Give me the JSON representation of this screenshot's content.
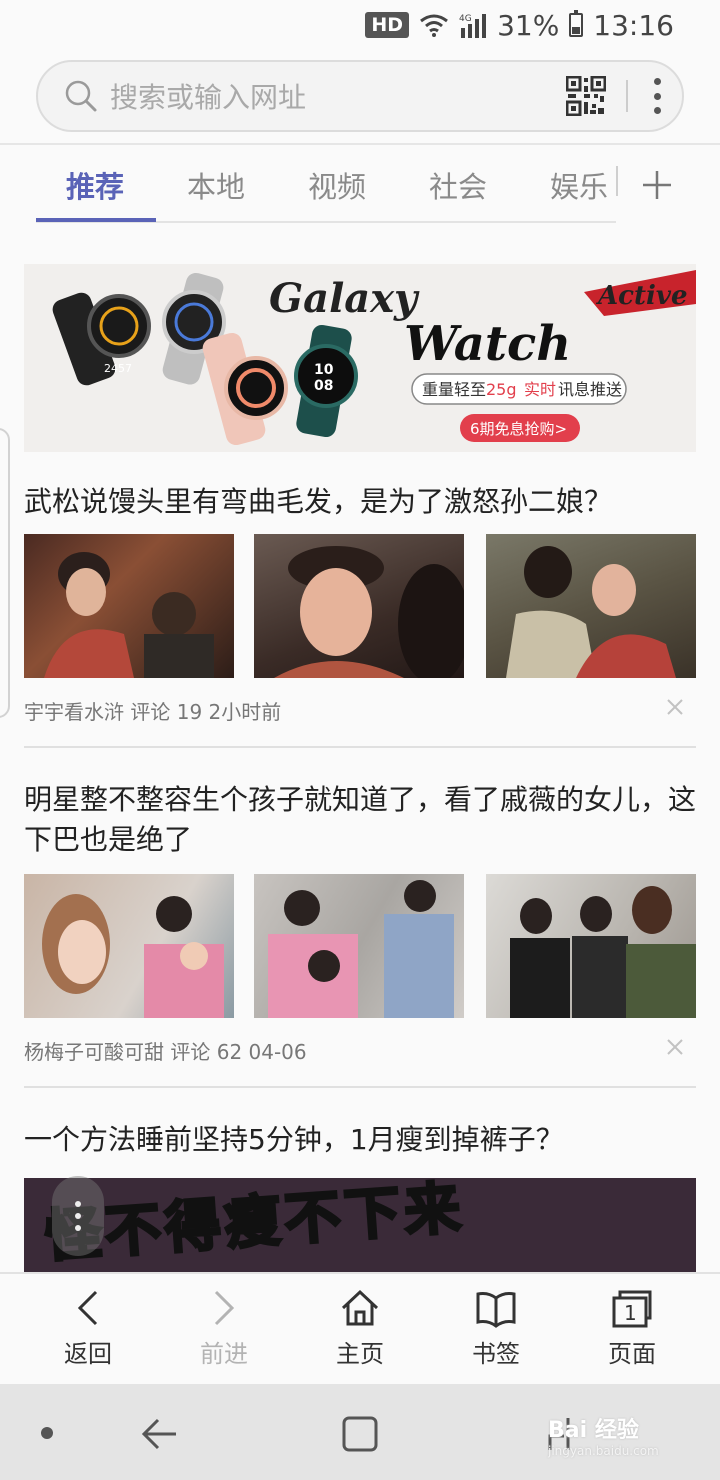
{
  "status_bar": {
    "hd": "HD",
    "battery": "31%",
    "time": "13:16"
  },
  "search": {
    "placeholder": "搜索或输入网址"
  },
  "tabs": [
    {
      "label": "推荐",
      "active": true
    },
    {
      "label": "本地"
    },
    {
      "label": "视频"
    },
    {
      "label": "社会"
    },
    {
      "label": "娱乐"
    }
  ],
  "banner": {
    "title_line1": "Galaxy",
    "title_line2": "Watch",
    "tag": "Active",
    "watch_time_1": "2457",
    "watch_time_2": "10",
    "watch_time_3": "08",
    "feature_a": "重量轻至",
    "feature_weight": "25g",
    "feature_b": "实时",
    "feature_c": "讯息推送",
    "cta": "6期免息抢购>"
  },
  "news": [
    {
      "title": "武松说馒头里有弯曲毛发，是为了激怒孙二娘？",
      "meta": "宇宇看水浒 评论 19 2小时前"
    },
    {
      "title": "明星整不整容生个孩子就知道了，看了戚薇的女儿，这下巴也是绝了",
      "meta": "杨梅子可酸可甜 评论 62 04-06"
    },
    {
      "title": "一个方法睡前坚持5分钟，1月瘦到掉裤子？",
      "image_text_a": "怪不得",
      "image_text_b": "瘦",
      "image_text_c": "不下来"
    }
  ],
  "toolbar": {
    "back": "返回",
    "forward": "前进",
    "home": "主页",
    "bookmarks": "书签",
    "tabs": "页面",
    "tab_count": "1"
  },
  "watermark": {
    "text": "Bai 经验",
    "sub": "jingyan.baidu.com"
  },
  "colors": {
    "accent": "#5a63b7",
    "banner_red": "#e23f4c"
  }
}
